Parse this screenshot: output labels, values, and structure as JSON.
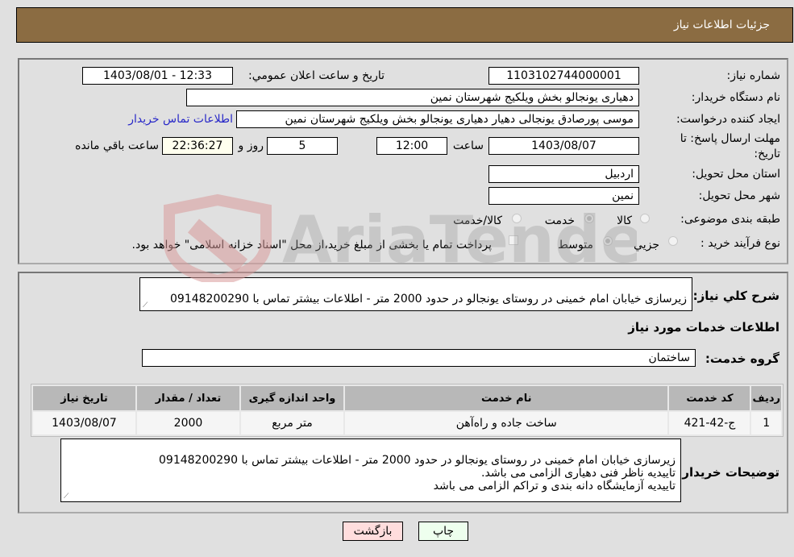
{
  "header": {
    "title": "جزئیات اطلاعات نیاز"
  },
  "fields": {
    "need_number": {
      "label": "شماره نیاز:",
      "value": "1103102744000001"
    },
    "announce_datetime": {
      "label": "تاریخ و ساعت اعلان عمومي:",
      "value": "1403/08/01 - 12:33"
    },
    "buyer_org": {
      "label": "نام دستگاه خریدار:",
      "value": "دهیاری یونجالو بخش ویلکیج شهرستان نمین"
    },
    "requester": {
      "label": "ایجاد کننده درخواست:",
      "value": "موسی پورصادق یونجالی دهیار دهیاری یونجالو بخش ویلکیج شهرستان نمین"
    },
    "buyer_contact_link": "اطلاعات تماس خریدار",
    "deadline": {
      "label": "مهلت ارسال پاسخ: تا تاریخ:",
      "date": "1403/08/07",
      "time_label": "ساعت",
      "time": "12:00",
      "days": "5",
      "days_label": "روز و",
      "remaining": "22:36:27",
      "remaining_label": "ساعت باقي مانده"
    },
    "province": {
      "label": "استان محل تحویل:",
      "value": "اردبیل"
    },
    "city": {
      "label": "شهر محل تحویل:",
      "value": "نمین"
    },
    "category": {
      "label": "طبقه بندی موضوعی:",
      "options": [
        "کالا",
        "خدمت",
        "کالا/خدمت"
      ],
      "selected": "خدمت"
    },
    "purchase_type": {
      "label": "نوع فرآیند خرید :",
      "options": [
        "جزيي",
        "متوسط"
      ],
      "selected": "متوسط",
      "treasury_note": "پرداخت تمام یا بخشی از مبلغ خرید،از محل \"اسناد خزانه اسلامی\" خواهد بود."
    }
  },
  "description": {
    "label": "شرح کلي نياز:",
    "value": "زیرسازی خیابان امام خمینی در روستای یونجالو در حدود 2000 متر - اطلاعات بیشتر تماس با 09148200290"
  },
  "services_section": {
    "title": "اطلاعات خدمات مورد نیاز",
    "group_label": "گروه خدمت:",
    "group_value": "ساختمان",
    "table": {
      "headers": [
        "ردیف",
        "کد خدمت",
        "نام خدمت",
        "واحد اندازه گیری",
        "تعداد / مقدار",
        "تاریخ نیاز"
      ],
      "rows": [
        [
          "1",
          "ج-42-421",
          "ساخت جاده و راه‌آهن",
          "متر مربع",
          "2000",
          "1403/08/07"
        ]
      ]
    }
  },
  "buyer_notes": {
    "label": "توضیحات خریدار:",
    "value": "زیرسازی خیابان امام خمینی در روستای یونجالو در حدود 2000 متر - اطلاعات بیشتر تماس با 09148200290\nتاییدیه ناظر فنی دهیاری الزامی می باشد.\nتاییدیه آزمایشگاه دانه بندی و تراکم الزامی می باشد"
  },
  "buttons": {
    "print": "چاپ",
    "back": "بازگشت"
  },
  "colors": {
    "header_bg": "#8b6c42",
    "print_bg": "#eeffee",
    "back_bg": "#ffdddd",
    "remaining_bg": "#ffffee",
    "link": "#2929c8"
  }
}
